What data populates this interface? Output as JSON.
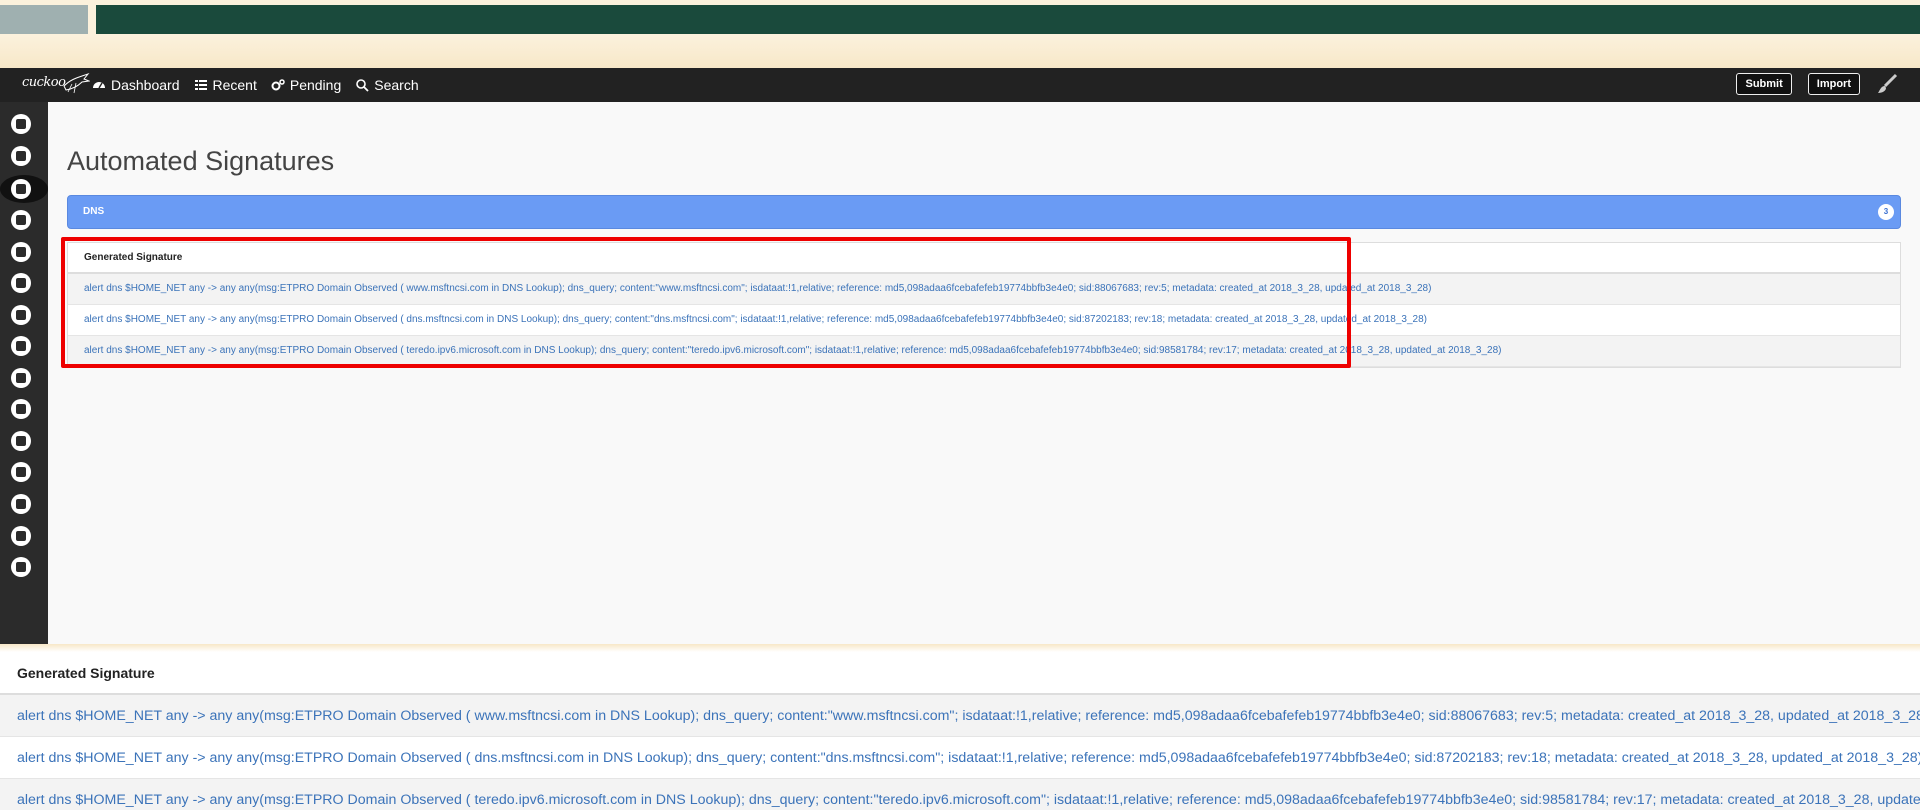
{
  "navbar": {
    "brand": "cuckoo",
    "items": [
      {
        "label": "Dashboard",
        "icon": "dashboard-icon"
      },
      {
        "label": "Recent",
        "icon": "list-icon"
      },
      {
        "label": "Pending",
        "icon": "cogs-icon"
      },
      {
        "label": "Search",
        "icon": "search-icon"
      }
    ],
    "submit_label": "Submit",
    "import_label": "Import"
  },
  "sidebar": {
    "icons": [
      "home-icon",
      "book-icon",
      "file-icon",
      "pencil-icon",
      "share-icon",
      "globe-icon",
      "file-text-icon",
      "list-icon",
      "table-icon",
      "shuffle-icon",
      "download-icon",
      "power-icon",
      "cogs-icon",
      "bug-icon",
      "lock-icon"
    ]
  },
  "page": {
    "title": "Automated Signatures",
    "section": "DNS",
    "section_count": "3"
  },
  "table": {
    "header": "Generated Signature",
    "rows": [
      "alert dns $HOME_NET any -> any any(msg:ETPRO Domain Observed ( www.msftncsi.com in DNS Lookup); dns_query; content:\"www.msftncsi.com\"; isdataat:!1,relative; reference: md5,098adaa6fcebafefeb19774bbfb3e4e0; sid:88067683; rev:5; metadata: created_at 2018_3_28, updated_at 2018_3_28)",
      "alert dns $HOME_NET any -> any any(msg:ETPRO Domain Observed ( dns.msftncsi.com in DNS Lookup); dns_query; content:\"dns.msftncsi.com\"; isdataat:!1,relative; reference: md5,098adaa6fcebafefeb19774bbfb3e4e0; sid:87202183; rev:18; metadata: created_at 2018_3_28, updated_at 2018_3_28)",
      "alert dns $HOME_NET any -> any any(msg:ETPRO Domain Observed ( teredo.ipv6.microsoft.com in DNS Lookup); dns_query; content:\"teredo.ipv6.microsoft.com\"; isdataat:!1,relative; reference: md5,098adaa6fcebafefeb19774bbfb3e4e0; sid:98581784; rev:17; metadata: created_at 2018_3_28, updated_at 2018_3_28)"
    ]
  },
  "colors": {
    "navbar": "#222222",
    "sidebar": "#2b2b2b",
    "dns_bar": "#6a9bf4",
    "link": "#3b73b9",
    "highlight": "#ee0000"
  }
}
